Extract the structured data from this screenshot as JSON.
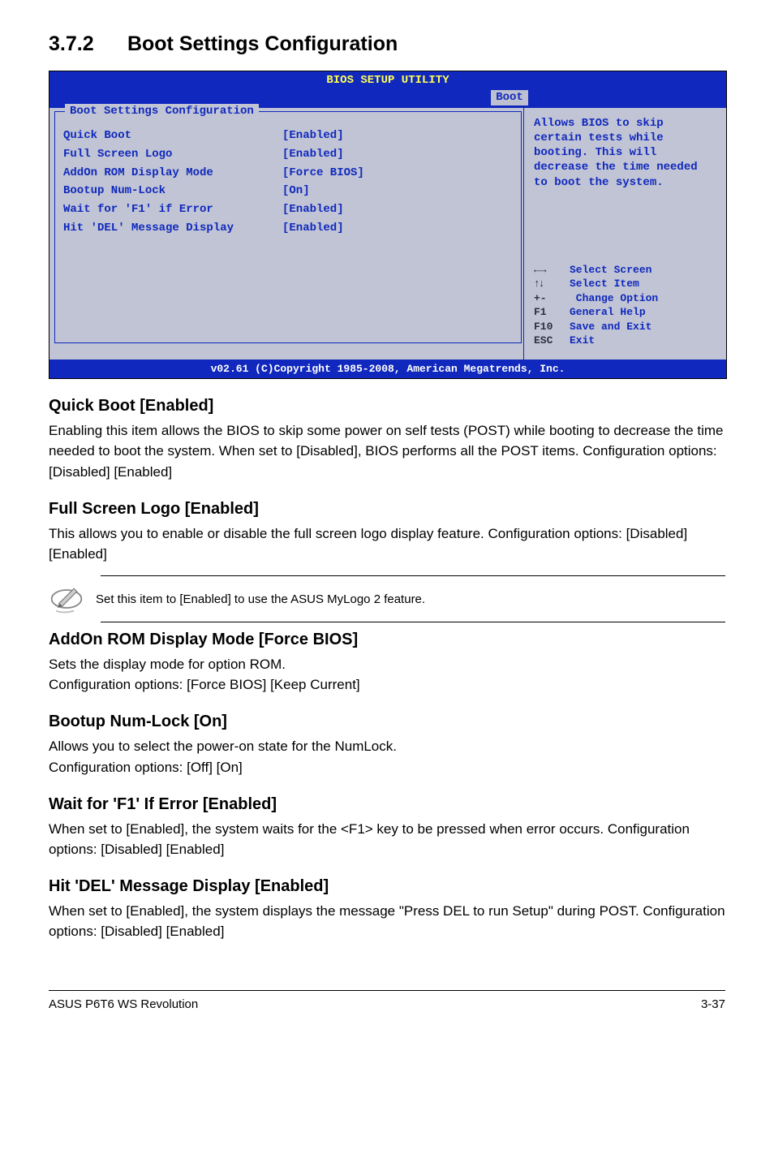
{
  "heading": {
    "num": "3.7.2",
    "title": "Boot Settings Configuration"
  },
  "bios": {
    "header_title": "BIOS SETUP UTILITY",
    "header_tab": "Boot",
    "box_title": "Boot Settings Configuration",
    "settings": [
      {
        "label": "Quick Boot",
        "value": "[Enabled]"
      },
      {
        "label": "Full Screen Logo",
        "value": "[Enabled]"
      },
      {
        "label": "AddOn ROM Display Mode",
        "value": "[Force BIOS]"
      },
      {
        "label": "Bootup Num-Lock",
        "value": "[On]"
      },
      {
        "label": "Wait for 'F1' if Error",
        "value": "[Enabled]"
      },
      {
        "label": "Hit 'DEL' Message Display",
        "value": "[Enabled]"
      }
    ],
    "help_text": "Allows BIOS to skip certain tests while booting. This will decrease the time needed to boot the system.",
    "legend": [
      {
        "sym": "←→",
        "txt": "Select Screen"
      },
      {
        "sym": "↑↓",
        "txt": "Select Item"
      },
      {
        "sym": "+-",
        "txt": " Change Option"
      },
      {
        "sym": "F1",
        "txt": "General Help"
      },
      {
        "sym": "F10",
        "txt": "Save and Exit"
      },
      {
        "sym": "ESC",
        "txt": "Exit"
      }
    ],
    "footer": "v02.61 (C)Copyright 1985-2008, American Megatrends, Inc."
  },
  "sections": {
    "quick_boot": {
      "title": "Quick Boot [Enabled]",
      "body": "Enabling this item allows the BIOS to skip some power on self tests (POST) while booting to decrease the time needed to boot the system. When set to [Disabled], BIOS performs all the POST items. Configuration options: [Disabled] [Enabled]"
    },
    "full_screen_logo": {
      "title": "Full Screen Logo [Enabled]",
      "body": "This allows you to enable or disable the full screen logo display feature. Configuration options: [Disabled] [Enabled]"
    },
    "note": {
      "text": "Set this item to [Enabled] to use the ASUS MyLogo 2 feature."
    },
    "addon_rom": {
      "title": "AddOn ROM Display Mode [Force BIOS]",
      "body": "Sets the display mode for option ROM.\nConfiguration options: [Force BIOS] [Keep Current]"
    },
    "bootup_numlock": {
      "title": "Bootup Num-Lock [On]",
      "body": "Allows you to select the power-on state for the NumLock.\nConfiguration options: [Off] [On]"
    },
    "wait_f1": {
      "title": "Wait for 'F1' If Error [Enabled]",
      "body": "When set to [Enabled], the system waits for the <F1> key to be pressed when error occurs. Configuration options: [Disabled] [Enabled]"
    },
    "hit_del": {
      "title": "Hit 'DEL' Message Display [Enabled]",
      "body": "When set to [Enabled], the system displays the message \"Press DEL to run Setup\" during POST. Configuration options: [Disabled] [Enabled]"
    }
  },
  "footer": {
    "left": "ASUS P6T6 WS Revolution",
    "right": "3-37"
  }
}
